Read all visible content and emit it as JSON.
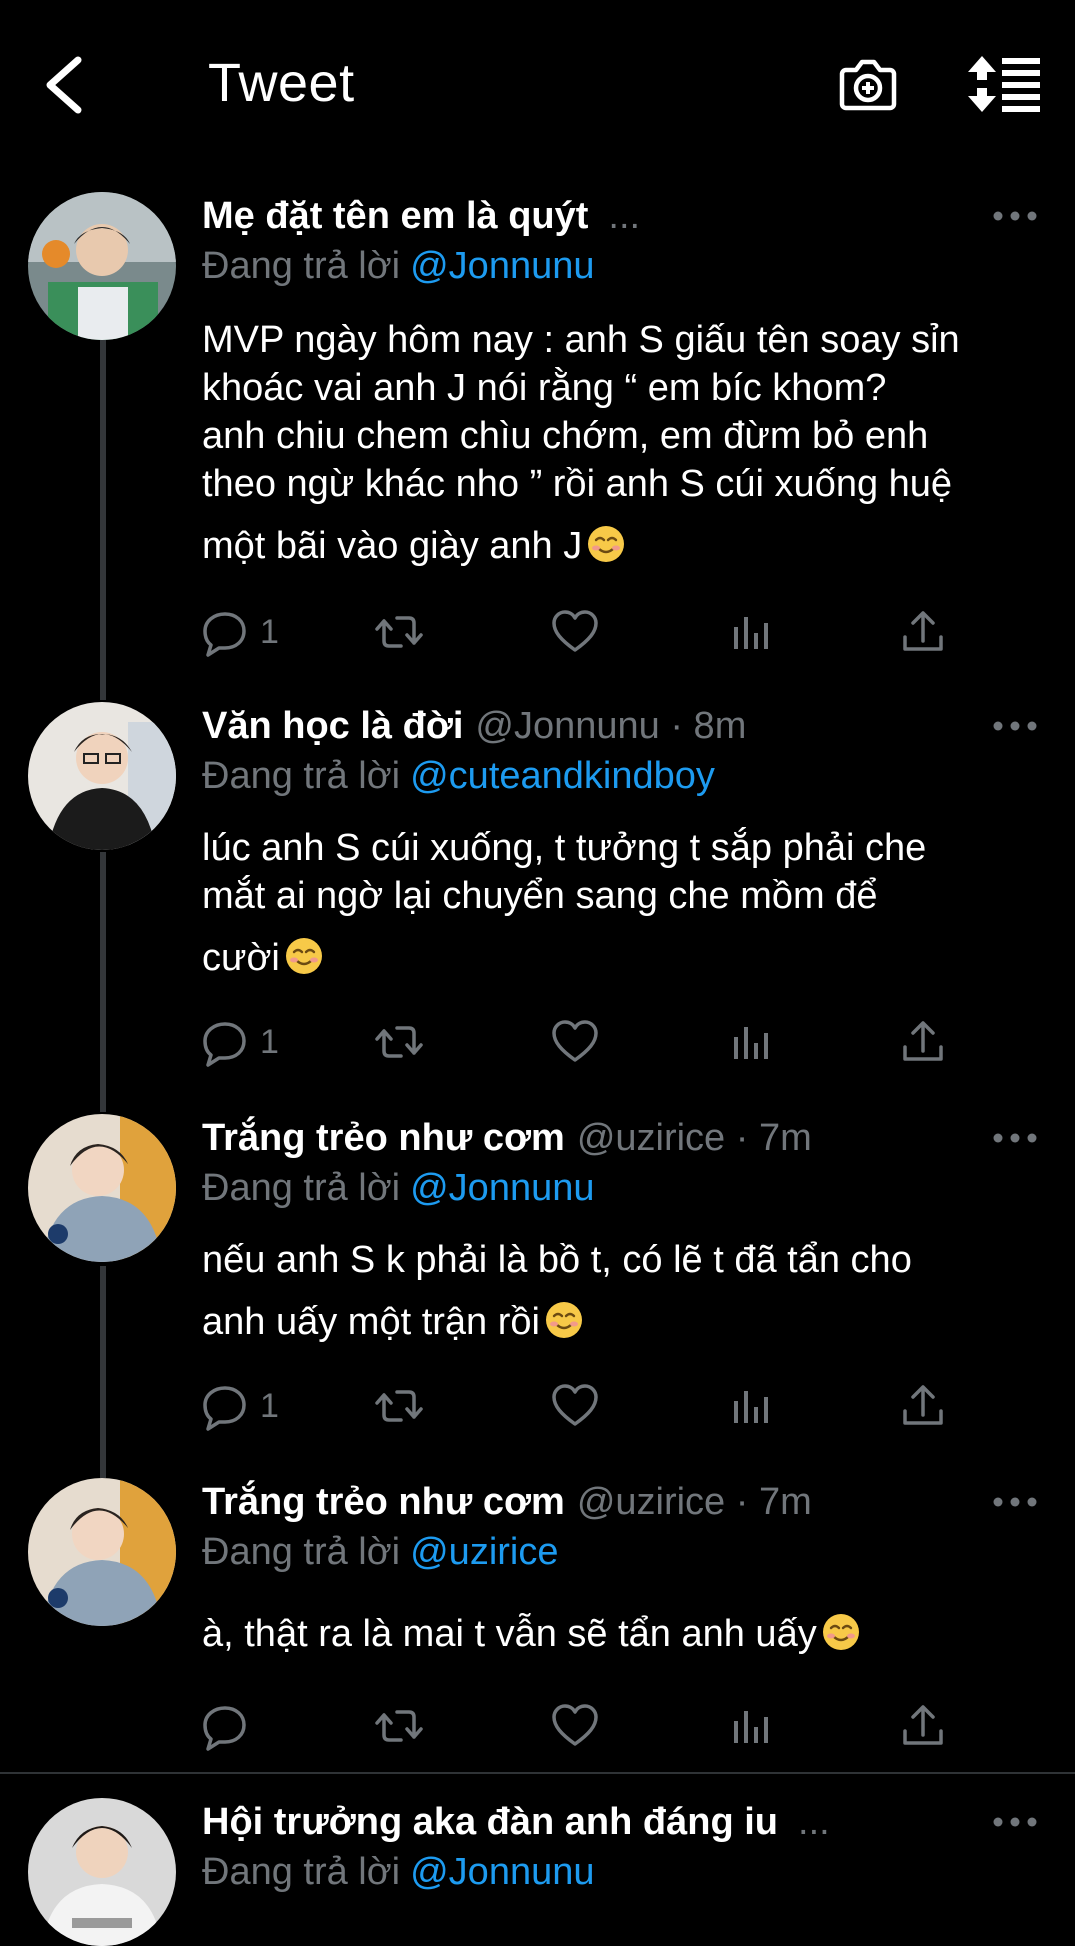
{
  "header": {
    "title": "Tweet",
    "back_icon": "chevron-left-icon",
    "camera_icon": "camera-add-icon",
    "sort_icon": "sort-icon"
  },
  "colors": {
    "background": "#000000",
    "accent": "#1d9bf0",
    "muted": "#71767b",
    "text": "#ffffff"
  },
  "reply_prefix": "Đang trả lời",
  "tweets": [
    {
      "name": "Mẹ đặt tên em là quýt",
      "meta": "",
      "truncated": "...",
      "reply_to": "@Jonnunu",
      "lines": [
        "MVP ngày hôm nay : anh S giấu tên soay sỉn",
        "khoác vai anh J nói rằng “ em bíc khom?",
        "anh chiu chem chìu chớm, em đừm bỏ enh",
        "theo ngừ khác nho ” rồi anh S cúi xuống huệ",
        "một bãi vào giày anh J"
      ],
      "reply_count": "1"
    },
    {
      "name": "Văn học là đời",
      "meta": "@Jonnunu · 8m",
      "truncated": "",
      "reply_to": "@cuteandkindboy",
      "lines": [
        "lúc anh S cúi xuống, t tưởng t sắp phải che",
        "mắt ai ngờ lại chuyển sang che mồm để",
        "cười"
      ],
      "reply_count": "1"
    },
    {
      "name": "Trắng trẻo như cơm",
      "meta": "@uzirice · 7m",
      "truncated": "",
      "reply_to": "@Jonnunu",
      "lines": [
        "nếu anh S k phải là bồ t, có lẽ t đã tẩn cho",
        "anh uấy một trận rồi"
      ],
      "reply_count": "1"
    },
    {
      "name": "Trắng trẻo như cơm",
      "meta": "@uzirice · 7m",
      "truncated": "",
      "reply_to": "@uzirice",
      "lines": [
        "à, thật ra là mai t vẫn sẽ tẩn anh uấy"
      ],
      "reply_count": ""
    },
    {
      "name": "Hội trưởng aka đàn anh đáng iu",
      "meta": "",
      "truncated": "...",
      "reply_to": "@Jonnunu",
      "lines": [],
      "reply_count": ""
    }
  ],
  "action_icons": [
    "reply-icon",
    "retweet-icon",
    "like-icon",
    "views-icon",
    "share-icon"
  ],
  "emoji": "smiling-face-icon"
}
